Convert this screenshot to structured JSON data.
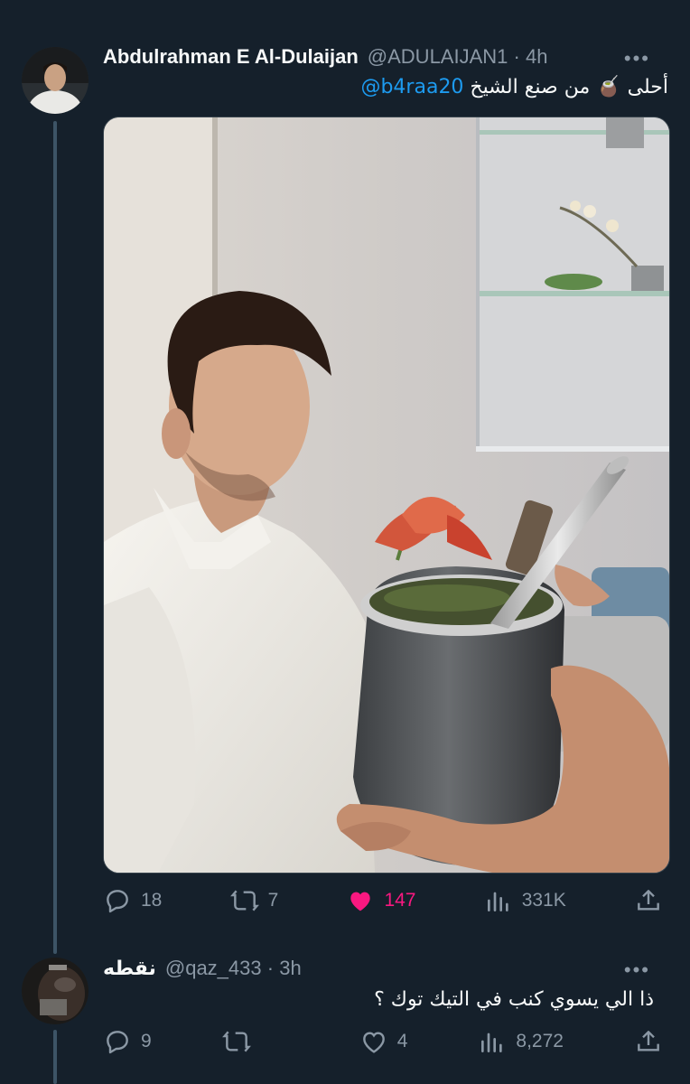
{
  "tweet1": {
    "author_name": "Abdulrahman E Al-Dulaijan",
    "handle": "@ADULAIJAN1",
    "time": "4h",
    "text_pre": "أحلى ",
    "text_emoji": "🧉",
    "text_mid": " من صنع الشيخ ",
    "mention": "@b4raa20",
    "replies": "18",
    "retweets": "7",
    "likes": "147",
    "views": "331K"
  },
  "tweet2": {
    "author_name": "نقطه",
    "handle": "@qaz_433",
    "time": "3h",
    "text": "ذا الي يسوي كنب في التيك توك ؟",
    "replies": "9",
    "retweets": "",
    "likes": "4",
    "views": "8,272"
  },
  "colors": {
    "background": "#15202b",
    "accent": "#1d9bf0",
    "like": "#f91880",
    "muted": "#8b98a5"
  }
}
